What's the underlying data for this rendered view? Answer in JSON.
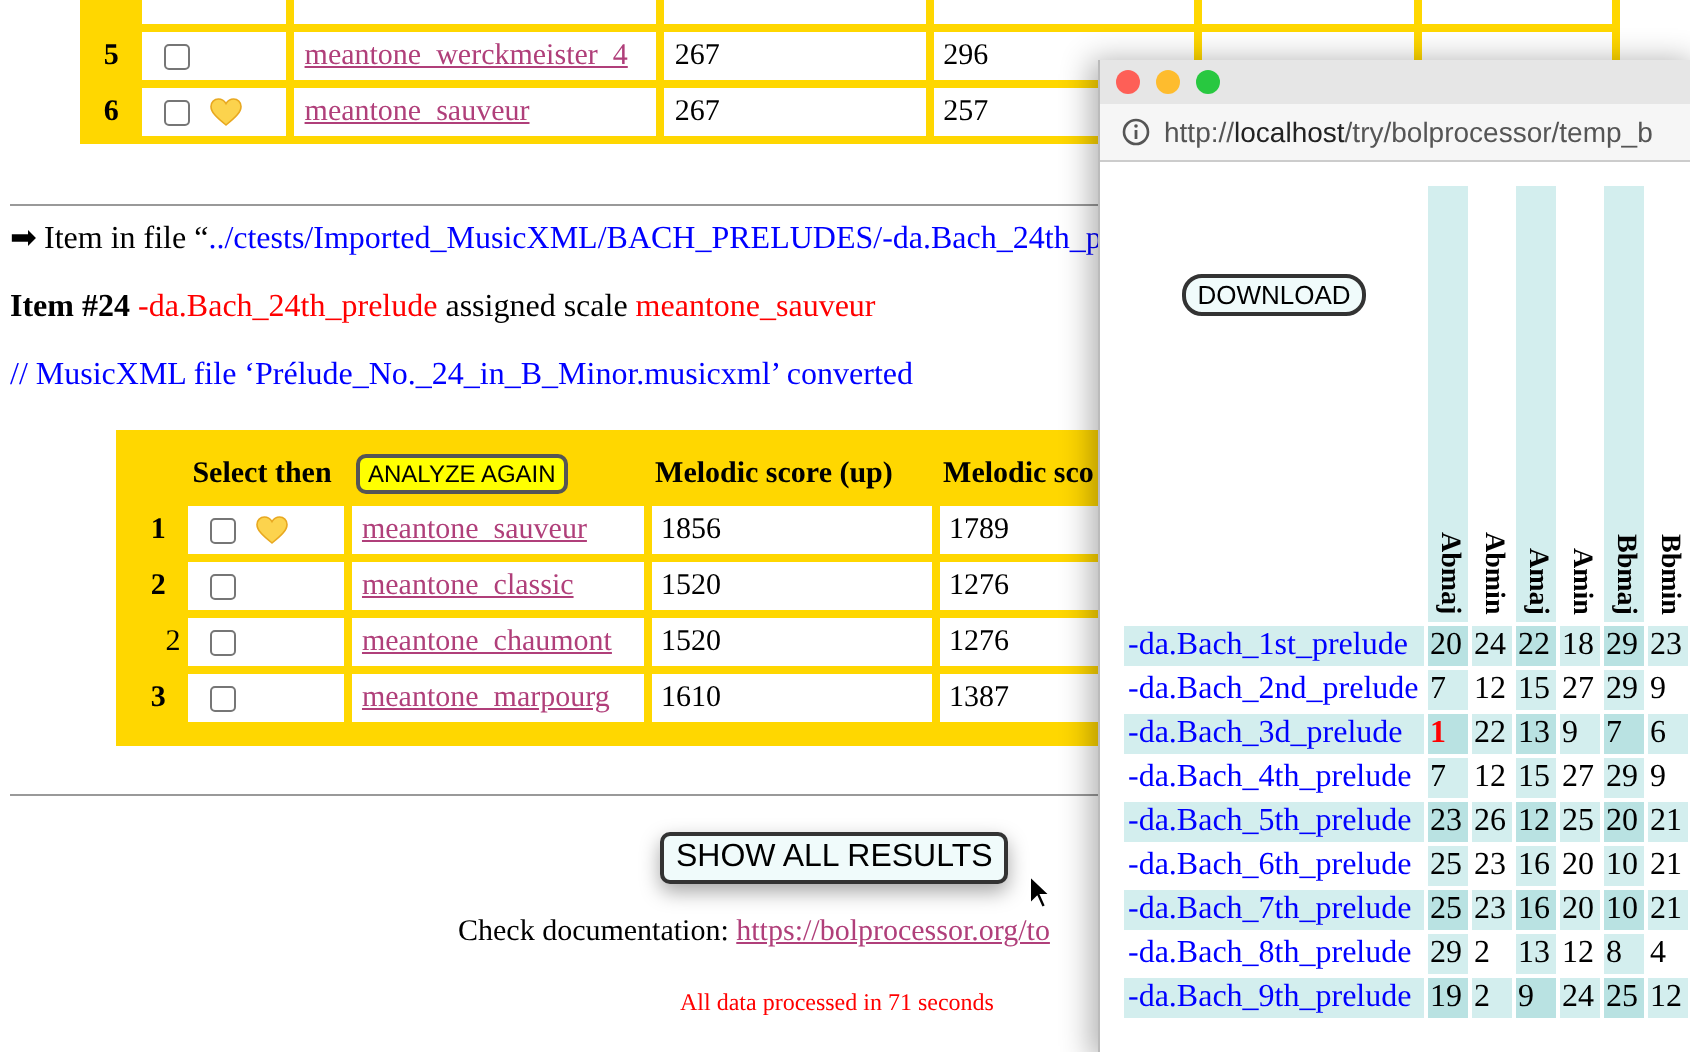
{
  "top_table": {
    "rows": [
      {
        "rank": "5",
        "checked": false,
        "favorite": false,
        "name": "meantone_werckmeister_4",
        "values": [
          "267",
          "296"
        ]
      },
      {
        "rank": "6",
        "checked": false,
        "favorite": true,
        "name": "meantone_sauveur",
        "values": [
          "267",
          "257"
        ]
      }
    ]
  },
  "item_file": {
    "prefix": "➡ Item in file “",
    "path": "../ctests/Imported_MusicXML/BACH_PRELUDES/-da.Bach_24th_p"
  },
  "item_line": {
    "label": "Item #24",
    "piece": "-da.Bach_24th_prelude",
    "middle": "assigned scale",
    "scale": "meantone_sauveur"
  },
  "converted_note": "// MusicXML file ‘Prélude_No._24_in_B_Minor.musicxml’ converted",
  "scores_table": {
    "select_header": "Select then",
    "analyze_button": "ANALYZE AGAIN",
    "columns": [
      "Melodic score (up)",
      "Melodic sco"
    ],
    "rows": [
      {
        "rank": "1",
        "bold": true,
        "checked": false,
        "favorite": true,
        "name": "meantone_sauveur",
        "values": [
          "1856",
          "1789"
        ]
      },
      {
        "rank": "2",
        "bold": true,
        "checked": false,
        "favorite": false,
        "name": "meantone_classic",
        "values": [
          "1520",
          "1276"
        ]
      },
      {
        "rank": "2",
        "bold": false,
        "checked": false,
        "favorite": false,
        "name": "meantone_chaumont",
        "values": [
          "1520",
          "1276"
        ]
      },
      {
        "rank": "3",
        "bold": true,
        "checked": false,
        "favorite": false,
        "name": "meantone_marpourg",
        "values": [
          "1610",
          "1387"
        ]
      }
    ]
  },
  "show_all_button": "SHOW ALL RESULTS",
  "documentation": {
    "label": "Check documentation:",
    "link": "https://bolprocessor.org/to"
  },
  "timing": "All data processed in 71 seconds",
  "popup": {
    "url_prefix": "http://",
    "url_host": "localhost",
    "url_rest": "/try/bolprocessor/temp_b",
    "download_button": "DOWNLOAD",
    "columns": [
      {
        "label": "Abmaj",
        "shaded": true
      },
      {
        "label": "Abmin",
        "shaded": false
      },
      {
        "label": "Amaj",
        "shaded": true
      },
      {
        "label": "Amin",
        "shaded": false
      },
      {
        "label": "Bbmaj",
        "shaded": true
      },
      {
        "label": "Bbmin",
        "shaded": false
      }
    ],
    "rows": [
      {
        "name": "-da.Bach_1st_prelude",
        "shaded": true,
        "cells": [
          {
            "text": "20",
            "best": false
          },
          {
            "text": "24",
            "best": false
          },
          {
            "text": "22",
            "best": false
          },
          {
            "text": "18",
            "best": false
          },
          {
            "text": "29",
            "best": false
          },
          {
            "text": "23",
            "best": false
          }
        ]
      },
      {
        "name": "-da.Bach_2nd_prelude",
        "shaded": false,
        "cells": [
          {
            "text": "7",
            "best": false
          },
          {
            "text": "12",
            "best": false
          },
          {
            "text": "15",
            "best": false
          },
          {
            "text": "27",
            "best": false
          },
          {
            "text": "29",
            "best": false
          },
          {
            "text": "9",
            "best": false
          }
        ]
      },
      {
        "name": "-da.Bach_3d_prelude",
        "shaded": true,
        "cells": [
          {
            "text": "1",
            "best": true
          },
          {
            "text": "22",
            "best": false
          },
          {
            "text": "13",
            "best": false
          },
          {
            "text": "9",
            "best": false
          },
          {
            "text": "7",
            "best": false
          },
          {
            "text": "6",
            "best": false
          }
        ]
      },
      {
        "name": "-da.Bach_4th_prelude",
        "shaded": false,
        "cells": [
          {
            "text": "7",
            "best": false
          },
          {
            "text": "12",
            "best": false
          },
          {
            "text": "15",
            "best": false
          },
          {
            "text": "27",
            "best": false
          },
          {
            "text": "29",
            "best": false
          },
          {
            "text": "9",
            "best": false
          }
        ]
      },
      {
        "name": "-da.Bach_5th_prelude",
        "shaded": true,
        "cells": [
          {
            "text": "23",
            "best": false
          },
          {
            "text": "26",
            "best": false
          },
          {
            "text": "12",
            "best": false
          },
          {
            "text": "25",
            "best": false
          },
          {
            "text": "20",
            "best": false
          },
          {
            "text": "21",
            "best": false
          }
        ]
      },
      {
        "name": "-da.Bach_6th_prelude",
        "shaded": false,
        "cells": [
          {
            "text": "25",
            "best": false
          },
          {
            "text": "23",
            "best": false
          },
          {
            "text": "16",
            "best": false
          },
          {
            "text": "20",
            "best": false
          },
          {
            "text": "10",
            "best": false
          },
          {
            "text": "21",
            "best": false
          }
        ]
      },
      {
        "name": "-da.Bach_7th_prelude",
        "shaded": true,
        "cells": [
          {
            "text": "25",
            "best": false
          },
          {
            "text": "23",
            "best": false
          },
          {
            "text": "16",
            "best": false
          },
          {
            "text": "20",
            "best": false
          },
          {
            "text": "10",
            "best": false
          },
          {
            "text": "21",
            "best": false
          }
        ]
      },
      {
        "name": "-da.Bach_8th_prelude",
        "shaded": false,
        "cells": [
          {
            "text": "29",
            "best": false
          },
          {
            "text": "2",
            "best": false
          },
          {
            "text": "13",
            "best": false
          },
          {
            "text": "12",
            "best": false
          },
          {
            "text": "8",
            "best": false
          },
          {
            "text": "4",
            "best": false
          }
        ]
      },
      {
        "name": "-da.Bach_9th_prelude",
        "shaded": true,
        "cells": [
          {
            "text": "19",
            "best": false
          },
          {
            "text": "2",
            "best": false
          },
          {
            "text": "9",
            "best": false
          },
          {
            "text": "24",
            "best": false
          },
          {
            "text": "25",
            "best": false
          },
          {
            "text": "12",
            "best": false
          }
        ]
      }
    ]
  }
}
